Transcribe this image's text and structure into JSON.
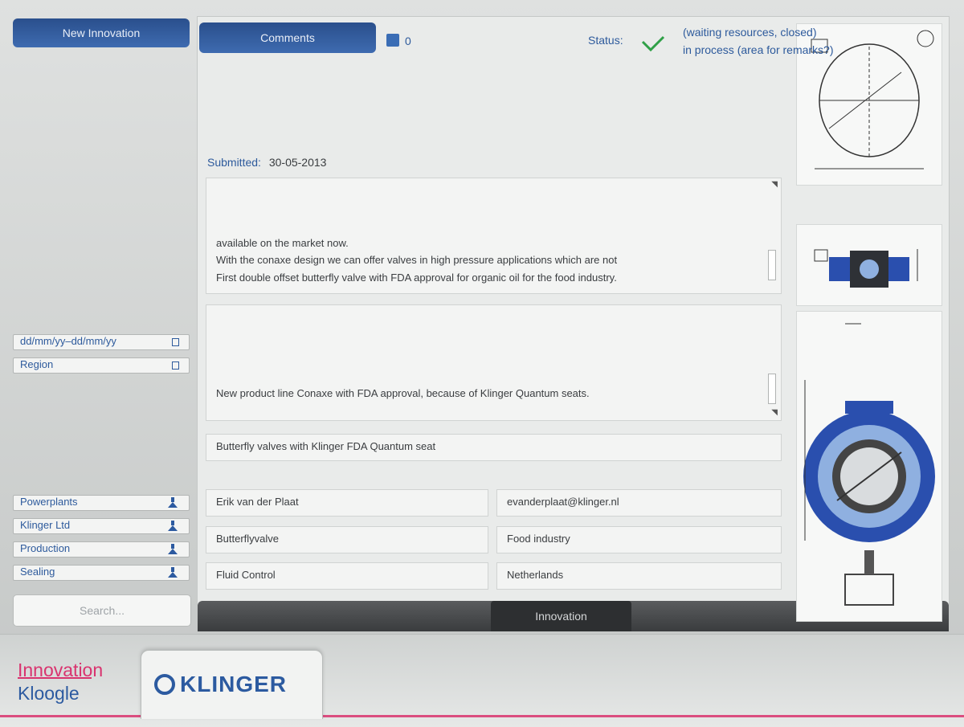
{
  "branding": {
    "app_name": "Kloogle",
    "app_subtitle": "Innovation",
    "company_logo_text": "KLINGER"
  },
  "sidebar": {
    "new_innovation_label": "New Innovation",
    "date_filter": "dd/mm/yy–dd/mm/yy",
    "region_filter": "Region",
    "categories": [
      {
        "label": "Powerplants"
      },
      {
        "label": "Klinger Ltd"
      },
      {
        "label": "Production"
      },
      {
        "label": "Sealing"
      }
    ],
    "search_placeholder": "Search..."
  },
  "header": {
    "comments_label": "Comments",
    "likes_count": "0",
    "status_label": "Status:",
    "status_line1": "in process (area for remarks?)",
    "status_line2": "(waiting resources, closed)"
  },
  "detail": {
    "submitted_label": "Submitted:",
    "submitted_date": "30-05-2013",
    "description_line1": "First double offset butterfly valve with FDA approval for organic oil for the food industry.",
    "description_line2": "With the conaxe design we can offer valves in high pressure applications which are not",
    "description_line3": "available on the market now.",
    "reason": "New product line Conaxe with FDA approval, because of Klinger Quantum seats.",
    "title": "Butterfly valves with Klinger FDA Quantum seat",
    "submitter_name": "Erik van der Plaat",
    "submitter_email": "evanderplaat@klinger.nl",
    "product": "Butterflyvalve",
    "market": "Food industry",
    "division": "Fluid Control",
    "country": "Netherlands"
  },
  "footer": {
    "innovation_tab": "Innovation"
  },
  "colors": {
    "accent_blue": "#2c5aa0",
    "brand_pink": "#d9336f",
    "bar_dark": "#3a3c3e"
  }
}
